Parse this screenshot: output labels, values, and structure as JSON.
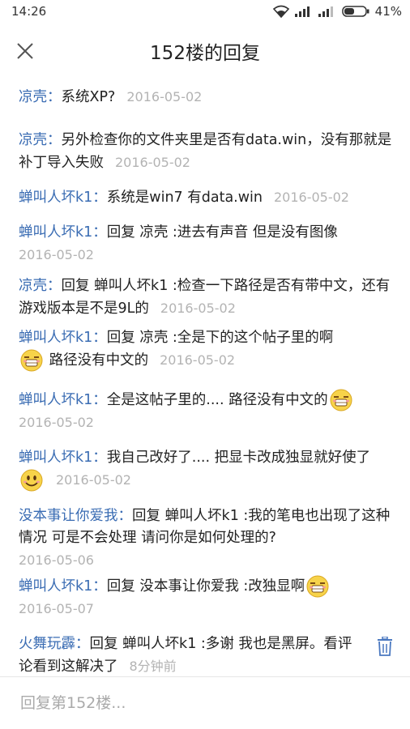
{
  "status_bar": {
    "time": "14:26",
    "battery": "41%"
  },
  "header": {
    "title": "152楼的回复"
  },
  "comments": [
    {
      "user": "凉壳",
      "text": "系统XP?",
      "time": "2016-05-02"
    },
    {
      "user": "凉壳",
      "text": "另外检查你的文件夹里是否有data.win，没有那就是补丁导入失败",
      "time": "2016-05-02"
    },
    {
      "user": "蝉叫人坏k1",
      "text": "系统是win7 有data.win",
      "time": "2016-05-02"
    },
    {
      "user": "蝉叫人坏k1",
      "text": "回复 凉壳 :进去有声音 但是没有图像",
      "time": "2016-05-02"
    },
    {
      "user": "凉壳",
      "text": "回复 蝉叫人坏k1 :检查一下路径是否有带中文，还有游戏版本是不是9L的",
      "time": "2016-05-02"
    },
    {
      "user": "蝉叫人坏k1",
      "text": "回复 凉壳 :全是下的这个帖子里的啊",
      "text2": "路径没有中文的",
      "time": "2016-05-02"
    },
    {
      "user": "蝉叫人坏k1",
      "text": "全是这帖子里的.... 路径没有中文的",
      "time": "2016-05-02"
    },
    {
      "user": "蝉叫人坏k1",
      "text": "我自己改好了.... 把显卡改成独显就好使了",
      "time": "2016-05-02"
    },
    {
      "user": "没本事让你爱我",
      "text": "回复 蝉叫人坏k1 :我的笔电也出现了这种情况 可是不会处理 请问你是如何处理的?",
      "time": "2016-05-06"
    },
    {
      "user": "蝉叫人坏k1",
      "text": "回复 没本事让你爱我 :改独显啊",
      "time": "2016-05-07"
    },
    {
      "user": "火舞玩霹",
      "text": "回复 蝉叫人坏k1 :多谢 我也是黑屏。看评论看到这解决了",
      "time": "8分钟前"
    }
  ],
  "reply_box": {
    "placeholder": "回复第152楼..."
  },
  "icons": {
    "close": "close-icon",
    "trash": "trash-icon",
    "emoji_cry": "crying-face-emoji",
    "emoji_smile": "smiling-face-emoji"
  },
  "colors": {
    "username": "#3a6cb3",
    "timestamp": "#b3b3b3",
    "trash": "#4a78c0"
  }
}
